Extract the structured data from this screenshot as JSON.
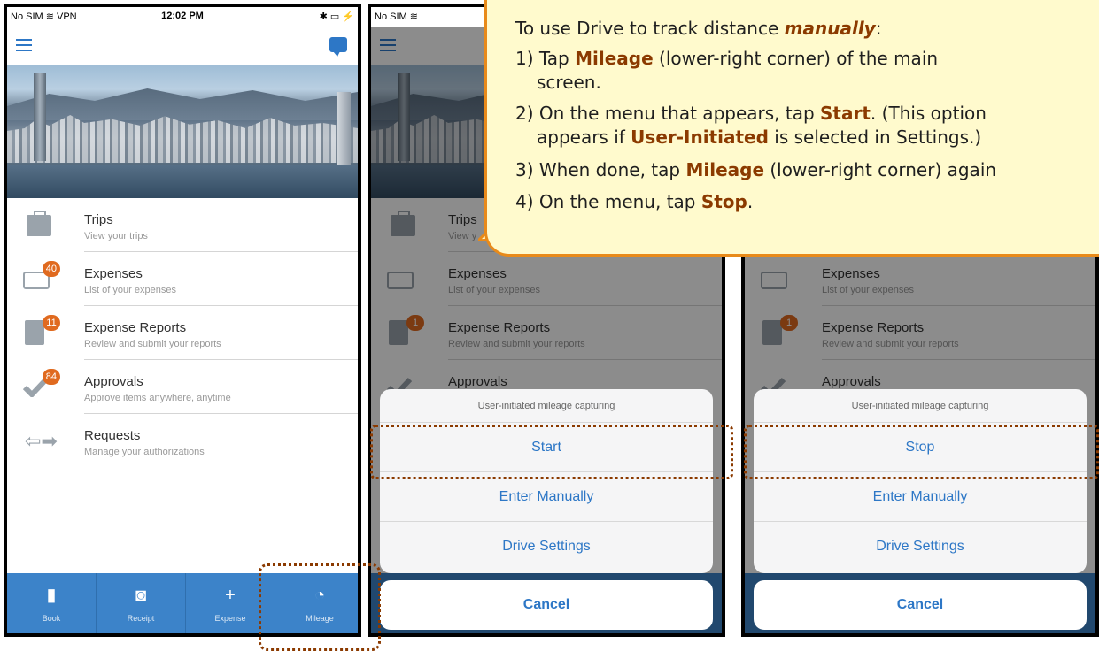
{
  "phone1": {
    "status": {
      "carrier": "No SIM ≋ VPN",
      "time": "12:02 PM",
      "battery": "✱ ▭ ⚡"
    },
    "list": [
      {
        "title": "Trips",
        "subtitle": "View your trips",
        "icon": "briefcase-icon",
        "badge": ""
      },
      {
        "title": "Expenses",
        "subtitle": "List of your expenses",
        "icon": "credit-card-icon",
        "badge": "40"
      },
      {
        "title": "Expense Reports",
        "subtitle": "Review and submit your reports",
        "icon": "report-document-icon",
        "badge": "11"
      },
      {
        "title": "Approvals",
        "subtitle": "Approve items anywhere, anytime",
        "icon": "checkmark-icon",
        "badge": "84"
      },
      {
        "title": "Requests",
        "subtitle": "Manage your authorizations",
        "icon": "arrows-exchange-icon",
        "badge": ""
      }
    ],
    "tabs": [
      {
        "label": "Book",
        "glyph": "▮",
        "icon": "briefcase-icon"
      },
      {
        "label": "Receipt",
        "glyph": "◙",
        "icon": "camera-icon"
      },
      {
        "label": "Expense",
        "glyph": "+",
        "icon": "plus-icon"
      },
      {
        "label": "Mileage",
        "glyph": "◔",
        "icon": "speedometer-icon"
      }
    ]
  },
  "phone2": {
    "status": {
      "carrier": "No SIM ≋"
    },
    "list": [
      {
        "title": "Trips",
        "subtitle": "View y"
      },
      {
        "title": "Expenses",
        "subtitle": "List of your expenses"
      },
      {
        "title": "Expense Reports",
        "subtitle": "Review and submit your reports",
        "badge": "1"
      },
      {
        "title": "Approvals",
        "subtitle": ""
      }
    ],
    "sheet": {
      "header": "User-initiated mileage capturing",
      "primary": "Start",
      "enter_manually": "Enter Manually",
      "drive_settings": "Drive Settings",
      "cancel": "Cancel"
    }
  },
  "phone3": {
    "list": [
      {
        "title": "Expenses",
        "subtitle": "List of your expenses"
      },
      {
        "title": "Expense Reports",
        "subtitle": "Review and submit your reports",
        "badge": "1"
      },
      {
        "title": "Approvals",
        "subtitle": ""
      }
    ],
    "sheet": {
      "header": "User-initiated mileage capturing",
      "primary": "Stop",
      "enter_manually": "Enter Manually",
      "drive_settings": "Drive Settings",
      "cancel": "Cancel"
    }
  },
  "callout": {
    "intro": "To use Drive to track distance ",
    "intro_em": "manually",
    "intro_end": ":",
    "step1_a": "1) Tap ",
    "step1_b": "Mileage",
    "step1_c": " (lower-right corner) of the main",
    "step1_d": "screen.",
    "step2_a": "2) On the menu that appears, tap ",
    "step2_b": "Start",
    "step2_c": ". (This option",
    "step2_d": "appears if ",
    "step2_e": "User-Initiated",
    "step2_f": " is selected in Settings.)",
    "step3_a": "3) When done, tap ",
    "step3_b": "Mileage",
    "step3_c": " (lower-right corner) again",
    "step4_a": "4) On the menu, tap ",
    "step4_b": "Stop",
    "step4_c": "."
  },
  "colors": {
    "accent": "#2d77c6",
    "tabbar": "#3c83c9",
    "badge": "#e06a1f",
    "callout_bg": "#fffacd",
    "callout_border": "#e88a1a",
    "highlight": "#8b3a00"
  }
}
